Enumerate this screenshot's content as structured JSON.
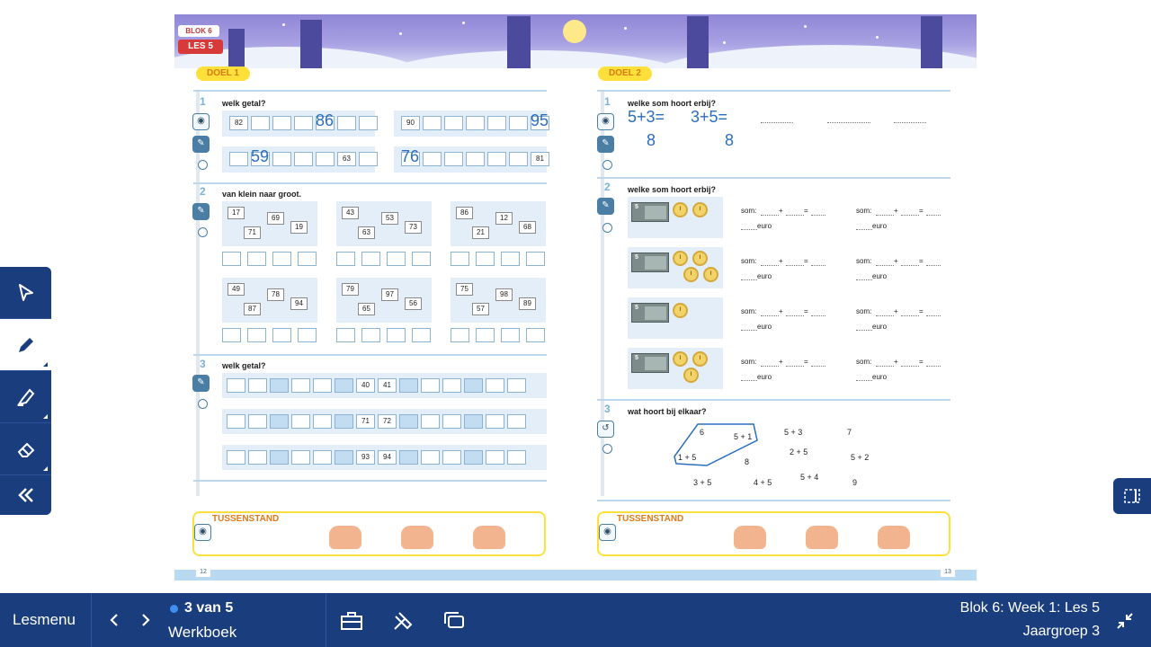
{
  "sheet": {
    "blok_badge": "BLOK 6",
    "les_badge": "LES 5",
    "left": {
      "goal": "DOEL 1",
      "ex1": {
        "num": "1",
        "title": "welk getal?",
        "printed": [
          "82",
          "90",
          "63",
          "81"
        ],
        "handwriting": [
          "86",
          "95",
          "59",
          "76"
        ]
      },
      "ex2": {
        "num": "2",
        "title": "van klein naar groot.",
        "groups": [
          [
            "17",
            "69",
            "71",
            "19"
          ],
          [
            "43",
            "53",
            "63",
            "73"
          ],
          [
            "86",
            "12",
            "21",
            "68"
          ],
          [
            "49",
            "78",
            "87",
            "94"
          ],
          [
            "79",
            "97",
            "65",
            "56"
          ],
          [
            "75",
            "98",
            "57",
            "89"
          ]
        ]
      },
      "ex3": {
        "num": "3",
        "title": "welk getal?",
        "rows": [
          [
            "40",
            "41"
          ],
          [
            "71",
            "72"
          ],
          [
            "93",
            "94"
          ]
        ]
      },
      "tussenstand": "TUSSENSTAND",
      "page": "12"
    },
    "right": {
      "goal": "DOEL 2",
      "ex1": {
        "num": "1",
        "title": "welke som hoort erbij?",
        "handwriting": [
          "5+3=",
          "3+5=",
          "8",
          "8"
        ]
      },
      "ex2": {
        "num": "2",
        "title": "welke som hoort erbij?",
        "note_value": "5",
        "coin_label": "1 euro",
        "sum_label": "som:",
        "plus": "+",
        "equals": "=",
        "euro": "euro"
      },
      "ex3": {
        "num": "3",
        "title": "wat hoort bij elkaar?",
        "items": [
          "6",
          "5 + 1",
          "5 + 3",
          "7",
          "2 + 5",
          "1 + 5",
          "8",
          "5 + 2",
          "5 + 4",
          "3 + 5",
          "4 + 5",
          "9"
        ]
      },
      "tussenstand": "TUSSENSTAND",
      "page": "13"
    }
  },
  "tools": {
    "items": [
      "select-tool",
      "pen-tool",
      "marker-tool",
      "eraser-tool",
      "collapse-tool"
    ],
    "active": "pen-tool"
  },
  "bottombar": {
    "lesmenu": "Lesmenu",
    "position": "3 van 5",
    "section": "Werkboek",
    "lesson": "Blok 6: Week 1: Les 5",
    "group": "Jaargroep 3"
  },
  "colors": {
    "navy": "#1a3d7e",
    "accent_blue": "#3f8ff0",
    "goal_yellow": "#ffe03a",
    "ink": "#2a6ebf"
  }
}
